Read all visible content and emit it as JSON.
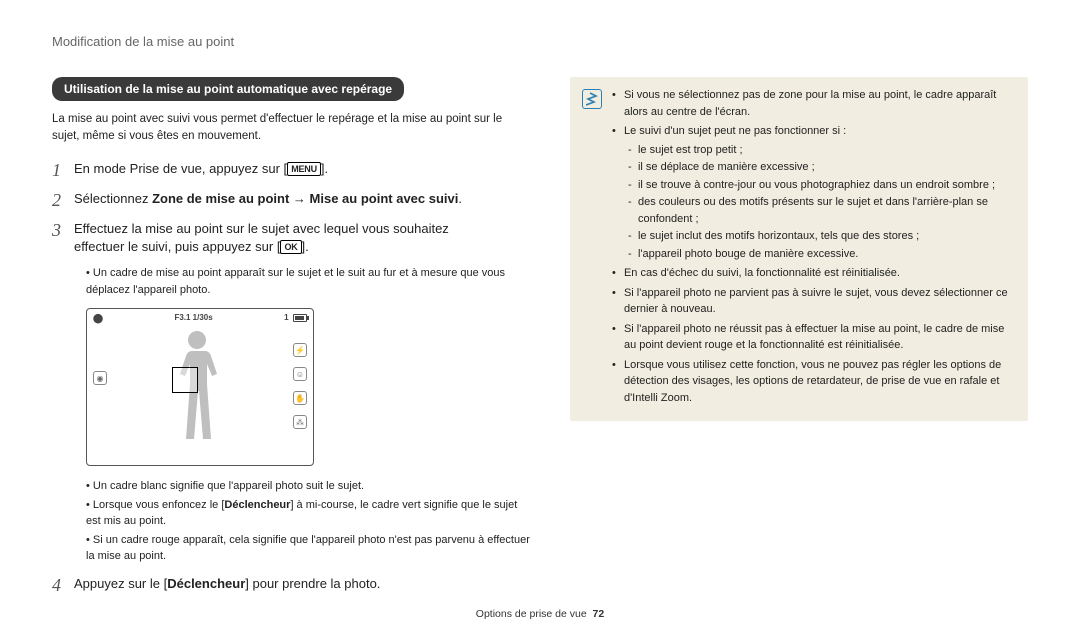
{
  "header": {
    "title": "Modification de la mise au point"
  },
  "section": {
    "pill": "Utilisation de la mise au point automatique avec repérage",
    "intro": "La mise au point avec suivi vous permet d'effectuer le repérage et la mise au point sur le sujet, même si vous êtes en mouvement."
  },
  "steps": {
    "s1": {
      "num": "1",
      "prefix": "En mode Prise de vue, appuyez sur [",
      "icon": "MENU",
      "suffix": "]."
    },
    "s2": {
      "num": "2",
      "prefix": "Sélectionnez ",
      "bold1": "Zone de mise au point",
      "arrow": " → ",
      "bold2": "Mise au point avec suivi",
      "suffix": "."
    },
    "s3": {
      "num": "3",
      "line1": "Effectuez la mise au point sur le sujet avec lequel vous souhaitez",
      "line2_prefix": "effectuer le suivi, puis appuyez sur [",
      "icon": "OK",
      "line2_suffix": "].",
      "b1": "Un cadre de mise au point apparaît sur le sujet et le suit au fur et à mesure que vous déplacez l'appareil photo.",
      "b2": "Un cadre blanc signifie que l'appareil photo suit le sujet.",
      "b3_prefix": "Lorsque vous enfoncez le [",
      "b3_bold": "Déclencheur",
      "b3_suffix": "] à mi-course, le cadre vert signifie que le sujet est mis au point.",
      "b4": "Si un cadre rouge apparaît, cela signifie que l'appareil photo n'est pas parvenu à effectuer la mise au point."
    },
    "s4": {
      "num": "4",
      "prefix": "Appuyez sur le [",
      "bold": "Déclencheur",
      "suffix": "] pour prendre la photo."
    }
  },
  "camera": {
    "top_left_mode": "⬤",
    "top_center": "F3.1 1/30s",
    "top_right_num": "1"
  },
  "note": {
    "n1": "Si vous ne sélectionnez pas de zone pour la mise au point, le cadre apparaît alors au centre de l'écran.",
    "n2": "Le suivi d'un sujet peut ne pas fonctionner si :",
    "n2a": "le sujet est trop petit ;",
    "n2b": "il se déplace de manière excessive ;",
    "n2c": "il se trouve à contre-jour ou vous photographiez dans un endroit sombre ;",
    "n2d": "des couleurs ou des motifs présents sur le sujet et dans l'arrière-plan se confondent ;",
    "n2e": "le sujet inclut des motifs horizontaux, tels que des stores ;",
    "n2f": "l'appareil photo bouge de manière excessive.",
    "n3": "En cas d'échec du suivi, la fonctionnalité est réinitialisée.",
    "n4": "Si l'appareil photo ne parvient pas à suivre le sujet, vous devez sélectionner ce dernier à nouveau.",
    "n5": "Si l'appareil photo ne réussit pas à effectuer la mise au point, le cadre de mise au point devient rouge et la fonctionnalité est réinitialisée.",
    "n6": "Lorsque vous utilisez cette fonction, vous ne pouvez pas régler les options de détection des visages, les options de retardateur, de prise de vue en rafale et d'Intelli Zoom."
  },
  "footer": {
    "chapter": "Options de prise de vue",
    "page": "72"
  }
}
